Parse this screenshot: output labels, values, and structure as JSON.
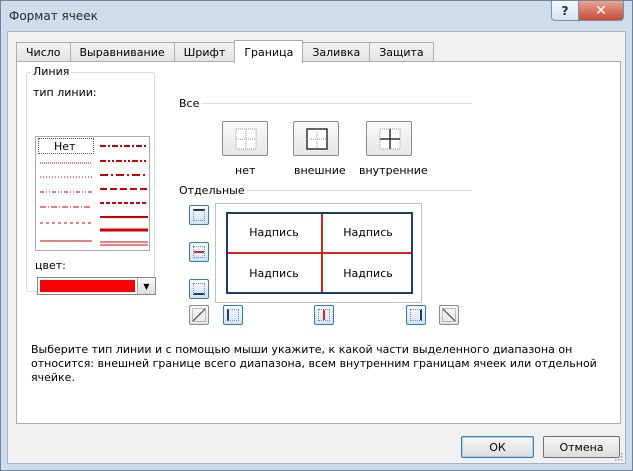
{
  "window": {
    "title": "Формат ячеек",
    "help_label": "?",
    "close_label": "✕"
  },
  "tabs": [
    {
      "label": "Число"
    },
    {
      "label": "Выравнивание"
    },
    {
      "label": "Шрифт"
    },
    {
      "label": "Граница",
      "active": true
    },
    {
      "label": "Заливка"
    },
    {
      "label": "Защита"
    }
  ],
  "line_group": {
    "title": "Линия",
    "style_label": "тип линии:",
    "none_label": "Нет",
    "color_label": "цвет:",
    "color_value": "#ff0000",
    "line_color": "#d40000"
  },
  "presets": {
    "title": "Все",
    "items": [
      {
        "label": "нет",
        "icon": "border-none-icon"
      },
      {
        "label": "внешние",
        "icon": "border-outline-icon"
      },
      {
        "label": "внутренние",
        "icon": "border-inside-icon"
      }
    ]
  },
  "border_group": {
    "title": "Отдельные",
    "preview_cells": [
      "Надпись",
      "Надпись",
      "Надпись",
      "Надпись"
    ],
    "outline_color": "#1f3e66",
    "inner_color": "#e0241b"
  },
  "description": "Выберите тип линии и с помощью мыши укажите, к какой части выделенного диапазона он относится: внешней границе всего диапазона, всем внутренним границам ячеек или отдельной ячейке.",
  "buttons": {
    "ok": "ОК",
    "cancel": "Отмена"
  }
}
